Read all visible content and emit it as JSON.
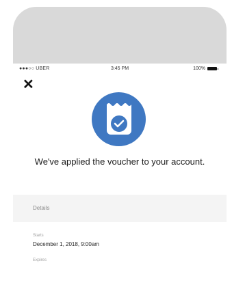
{
  "status_bar": {
    "carrier": "●●●○○ UBER",
    "time": "3:45 PM",
    "battery": "100%"
  },
  "close_symbol": "✕",
  "headline": "We've applied the voucher to your account.",
  "details": {
    "section_label": "Details",
    "starts_label": "Starts",
    "starts_value": "December 1, 2018, 9:00am",
    "expires_label": "Expires"
  },
  "colors": {
    "voucher_blue": "#3f78c2",
    "phone_frame": "#d9d9d9"
  },
  "icons": [
    "close-icon",
    "voucher-icon",
    "checkmark-icon",
    "battery-icon"
  ]
}
